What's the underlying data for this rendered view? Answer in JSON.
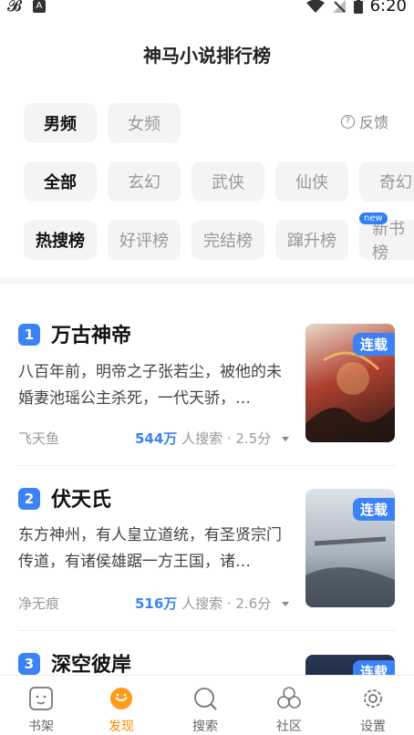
{
  "status_bar": {
    "time": "6:20",
    "left_icons": [
      "bird-icon",
      "a-icon"
    ],
    "right_icons": [
      "wifi-icon",
      "signal-icon",
      "battery-icon"
    ]
  },
  "title": "神马小说排行榜",
  "filters": {
    "gender": [
      {
        "label": "男频",
        "active": true
      },
      {
        "label": "女频",
        "active": false
      }
    ],
    "genre": [
      {
        "label": "全部",
        "active": true
      },
      {
        "label": "玄幻",
        "active": false
      },
      {
        "label": "武侠",
        "active": false
      },
      {
        "label": "仙侠",
        "active": false
      },
      {
        "label": "奇幻",
        "active": false
      }
    ],
    "list": [
      {
        "label": "热搜榜",
        "active": true
      },
      {
        "label": "好评榜",
        "active": false
      },
      {
        "label": "完结榜",
        "active": false
      },
      {
        "label": "蹿升榜",
        "active": false
      },
      {
        "label": "新书榜",
        "active": false,
        "badge": "new"
      }
    ]
  },
  "feedback": {
    "label": "反馈",
    "icon": "question-circle-icon"
  },
  "books": [
    {
      "rank": "1",
      "title": "万古神帝",
      "description": "八百年前，明帝之子张若尘，被他的未婚妻池瑶公主杀死，一代天骄，…",
      "author": "飞天鱼",
      "searches": "544万",
      "stats_suffix": " 人搜索 · 2.5分",
      "tag": "连载",
      "cover_accent": "#7a2a1a"
    },
    {
      "rank": "2",
      "title": "伏天氏",
      "description": "东方神州，有人皇立道统，有圣贤宗门传道，有诸侯雄踞一方王国，诸…",
      "author": "净无痕",
      "searches": "516万",
      "stats_suffix": " 人搜索 · 2.6分",
      "tag": "连载",
      "cover_accent": "#6e7f90"
    },
    {
      "rank": "3",
      "title": "深空彼岸",
      "description": "",
      "author": "",
      "searches": "",
      "stats_suffix": "",
      "tag": "连载",
      "cover_accent": "#1f2a44"
    }
  ],
  "tabbar": [
    {
      "label": "书架",
      "icon": "bookshelf-icon",
      "active": false
    },
    {
      "label": "发现",
      "icon": "discover-icon",
      "active": true
    },
    {
      "label": "搜索",
      "icon": "search-icon",
      "active": false
    },
    {
      "label": "社区",
      "icon": "community-icon",
      "active": false
    },
    {
      "label": "设置",
      "icon": "settings-icon",
      "active": false
    }
  ],
  "colors": {
    "accent": "#3b82f6",
    "active_tab": "#ff8a00"
  }
}
